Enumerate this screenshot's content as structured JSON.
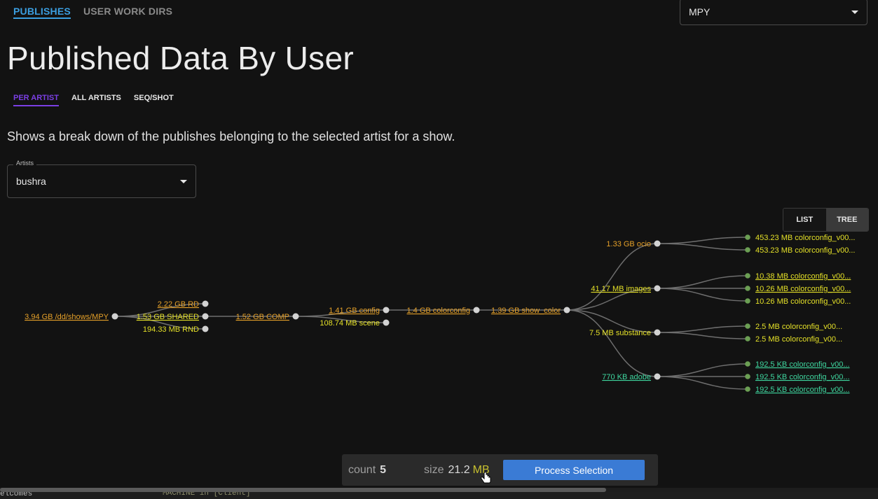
{
  "header": {
    "tabs": [
      {
        "label": "PUBLISHES"
      },
      {
        "label": "USER WORK DIRS"
      }
    ],
    "show_select": {
      "value": "MPY"
    }
  },
  "page": {
    "title": "Published Data By User",
    "subtabs": [
      {
        "label": "PER ARTIST"
      },
      {
        "label": "ALL ARTISTS"
      },
      {
        "label": "SEQ/SHOT"
      }
    ],
    "description": "Shows a break down of the publishes belonging to the selected artist for a show.",
    "artist_field": {
      "legend": "Artists",
      "value": "bushra"
    },
    "view_toggle": {
      "list_label": "LIST",
      "tree_label": "TREE",
      "selected": "TREE"
    }
  },
  "colors": {
    "node_gray": "#d2d2d2",
    "node_green": "#6b9f53",
    "link": "#6e6e6e",
    "orange": "#e6a129",
    "yellow": "#e4e028",
    "green_text": "#3fd8a0"
  },
  "tree": [
    {
      "id": "root",
      "label": "3.94 GB /dd/shows/MPY",
      "color": "orange",
      "underline": true
    },
    {
      "id": "rd",
      "parent": "root",
      "label": "2.22 GB RD",
      "color": "orange",
      "underline": true
    },
    {
      "id": "shared",
      "parent": "root",
      "label": "1.53 GB SHARED",
      "color": "yellow",
      "underline": true
    },
    {
      "id": "rnd",
      "parent": "root",
      "label": "194.33 MB RND",
      "color": "yellow",
      "underline": false
    },
    {
      "id": "comp",
      "parent": "shared",
      "label": "1.52 GB COMP",
      "color": "orange",
      "underline": true
    },
    {
      "id": "config",
      "parent": "comp",
      "label": "1.41 GB config",
      "color": "orange",
      "underline": true
    },
    {
      "id": "scene",
      "parent": "comp",
      "label": "108.74 MB scene",
      "color": "yellow",
      "underline": false
    },
    {
      "id": "colorconfig",
      "parent": "config",
      "label": "1.4 GB colorconfig",
      "color": "orange",
      "underline": true
    },
    {
      "id": "show_color",
      "parent": "colorconfig",
      "label": "1.39 GB show_color",
      "color": "orange",
      "underline": true
    },
    {
      "id": "ocio",
      "parent": "show_color",
      "label": "1.33 GB ocio",
      "color": "orange",
      "underline": false
    },
    {
      "id": "images",
      "parent": "show_color",
      "label": "41.17 MB images",
      "color": "yellow",
      "underline": true
    },
    {
      "id": "substance",
      "parent": "show_color",
      "label": "7.5 MB substance",
      "color": "yellow",
      "underline": false
    },
    {
      "id": "adobe",
      "parent": "show_color",
      "label": "770 KB adobe",
      "color": "green_text",
      "underline": true
    },
    {
      "id": "o1",
      "parent": "ocio",
      "label": "453.23 MB colorconfig_v00...",
      "color": "yellow",
      "underline": false
    },
    {
      "id": "o2",
      "parent": "ocio",
      "label": "453.23 MB colorconfig_v00...",
      "color": "yellow",
      "underline": false
    },
    {
      "id": "i1",
      "parent": "images",
      "label": "10.38 MB colorconfig_v00...",
      "color": "yellow",
      "underline": true
    },
    {
      "id": "i2",
      "parent": "images",
      "label": "10.26 MB colorconfig_v00...",
      "color": "yellow",
      "underline": true
    },
    {
      "id": "i3",
      "parent": "images",
      "label": "10.26 MB colorconfig_v00...",
      "color": "yellow",
      "underline": false
    },
    {
      "id": "s1",
      "parent": "substance",
      "label": "2.5 MB colorconfig_v00...",
      "color": "yellow",
      "underline": false
    },
    {
      "id": "s2",
      "parent": "substance",
      "label": "2.5 MB colorconfig_v00...",
      "color": "yellow",
      "underline": false
    },
    {
      "id": "a1",
      "parent": "adobe",
      "label": "192.5 KB colorconfig_v00...",
      "color": "green_text",
      "underline": true
    },
    {
      "id": "a2",
      "parent": "adobe",
      "label": "192.5 KB colorconfig_v00...",
      "color": "green_text",
      "underline": true
    },
    {
      "id": "a3",
      "parent": "adobe",
      "label": "192.5 KB colorconfig_v00...",
      "color": "green_text",
      "underline": true
    }
  ],
  "selection": {
    "count_label": "count",
    "count_value": "5",
    "size_label": "size",
    "size_value": "21.2",
    "size_unit": "MB",
    "button_label": "Process Selection"
  },
  "background_strip": {
    "left_text": "elcomes",
    "mid_text": "MACHINE in [Client]"
  }
}
